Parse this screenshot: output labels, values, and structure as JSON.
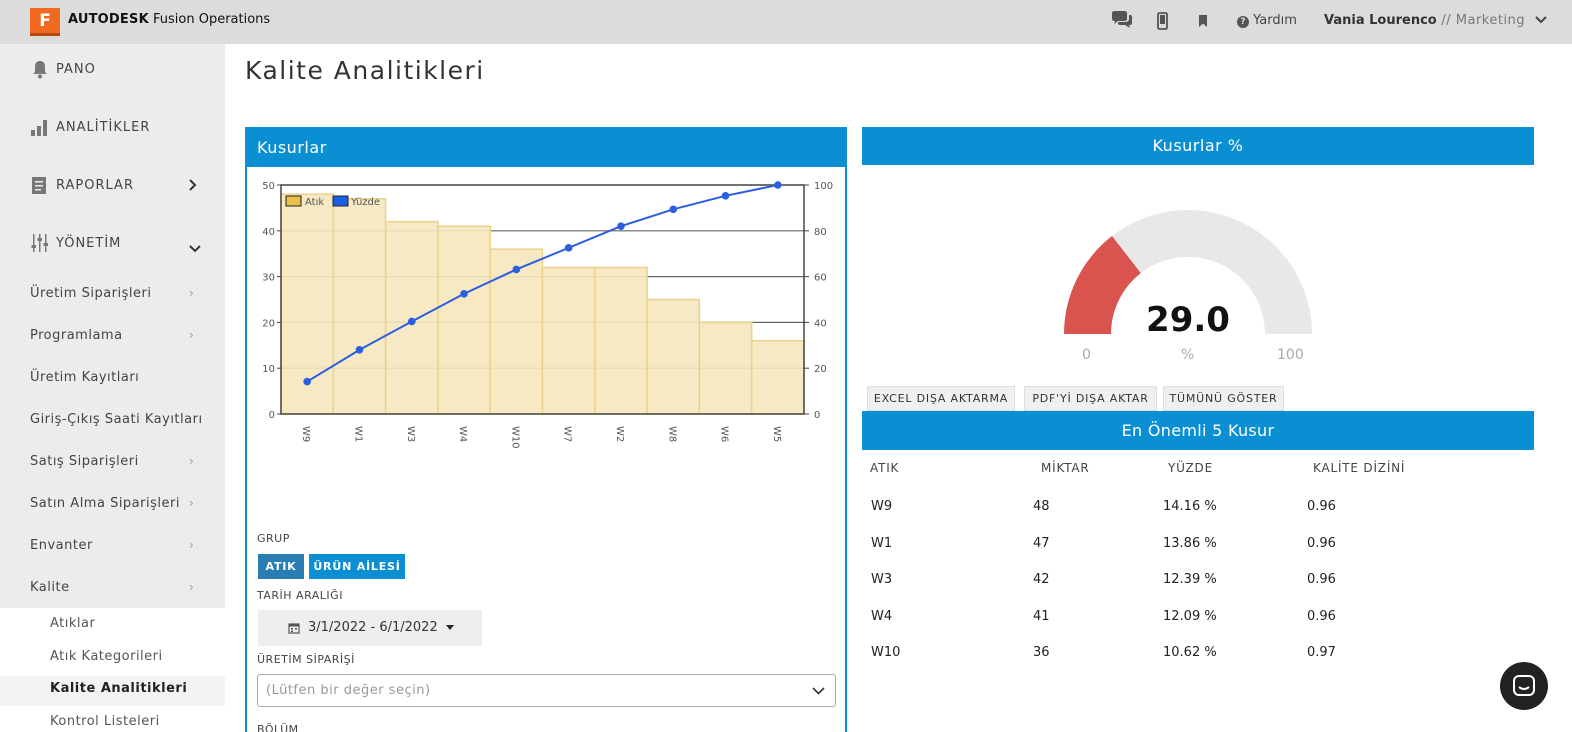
{
  "topbar": {
    "logo_letter": "F",
    "brand_bold": "AUTODESK",
    "brand_rest": " Fusion Operations",
    "icons": [
      "chat-icon",
      "mobile-icon",
      "bookmark-icon"
    ],
    "help_label": "Yardım",
    "user_name": "Vania Lourenco",
    "user_role": " // Marketing"
  },
  "sidebar": {
    "main": [
      {
        "label": "PANO",
        "icon": "bell-icon"
      },
      {
        "label": "ANALİTİKLER",
        "icon": "bar-chart-icon"
      },
      {
        "label": "RAPORLAR",
        "icon": "report-icon"
      },
      {
        "label": "YÖNETİM",
        "icon": "sliders-icon"
      }
    ],
    "sub": [
      {
        "label": "Üretim Siparişleri",
        "chevron": true
      },
      {
        "label": "Programlama",
        "chevron": true
      },
      {
        "label": "Üretim Kayıtları",
        "chevron": false
      },
      {
        "label": "Giriş-Çıkış Saati Kayıtları",
        "chevron": false
      },
      {
        "label": "Satış Siparişleri",
        "chevron": true
      },
      {
        "label": "Satın Alma Siparişleri",
        "chevron": true
      },
      {
        "label": "Envanter",
        "chevron": true
      },
      {
        "label": "Kalite",
        "chevron": true
      }
    ],
    "quality_items": [
      "Atıklar",
      "Atık Kategorileri",
      "Kalite Analitikleri",
      "Kontrol Listeleri"
    ]
  },
  "page": {
    "title": "Kalite Analitikleri"
  },
  "defects_panel": {
    "title": "Kusurlar",
    "group_label": "GRUP",
    "group_buttons": [
      "ATIK",
      "ÜRÜN AİLESİ"
    ],
    "date_label": "TARİH ARALIĞI",
    "date_value": "3/1/2022 - 6/1/2022",
    "order_label": "ÜRETİM SİPARİŞİ",
    "order_placeholder": "(Lütfen bir değer seçin)",
    "section_label": "BÖLÜM"
  },
  "chart_data": {
    "type": "bar",
    "categories": [
      "W9",
      "W1",
      "W3",
      "W4",
      "W10",
      "W7",
      "W2",
      "W8",
      "W6",
      "W5"
    ],
    "series": [
      {
        "name": "Atık",
        "type": "bar",
        "values": [
          48,
          47,
          42,
          41,
          36,
          32,
          32,
          25,
          20,
          16
        ]
      },
      {
        "name": "Yüzde",
        "type": "line",
        "axis": "right",
        "values": [
          14.16,
          28.02,
          40.41,
          52.5,
          63.12,
          72.56,
          82.0,
          89.38,
          95.28,
          100
        ]
      }
    ],
    "ylim": [
      0,
      50
    ],
    "y2lim": [
      0,
      100
    ],
    "yticks": [
      0,
      10,
      20,
      30,
      40,
      50
    ],
    "y2ticks": [
      0,
      20,
      40,
      60,
      80,
      100
    ],
    "legend": "top-left",
    "colors": {
      "bar_fill": "#f5e7bc",
      "bar_stroke": "#ecd28a",
      "line": "#2b5fe0",
      "legend_bar": "#e8c04a",
      "legend_line": "#1a5ee6"
    }
  },
  "gauge": {
    "title": "Kusurlar %",
    "value": 29.0,
    "value_label": "29.0",
    "min_label": "0",
    "unit_label": "%",
    "max_label": "100",
    "colors": {
      "fill": "#d9534f",
      "track": "#e8e8e8"
    }
  },
  "export_buttons": [
    "EXCEL DIŞA AKTARMA",
    "PDF'Yİ DIŞA AKTAR",
    "TÜMÜNÜ GÖSTER"
  ],
  "top5": {
    "title": "En Önemli 5 Kusur",
    "headers": [
      "ATIK",
      "MİKTAR",
      "YÜZDE",
      "KALİTE DİZİNİ"
    ],
    "rows": [
      [
        "W9",
        "48",
        "14.16 %",
        "0.96"
      ],
      [
        "W1",
        "47",
        "13.86 %",
        "0.96"
      ],
      [
        "W3",
        "42",
        "12.39 %",
        "0.96"
      ],
      [
        "W4",
        "41",
        "12.09 %",
        "0.96"
      ],
      [
        "W10",
        "36",
        "10.62 %",
        "0.97"
      ]
    ]
  },
  "colors": {
    "accent": "#0b8fd3",
    "group_active": "#2a7db3"
  }
}
